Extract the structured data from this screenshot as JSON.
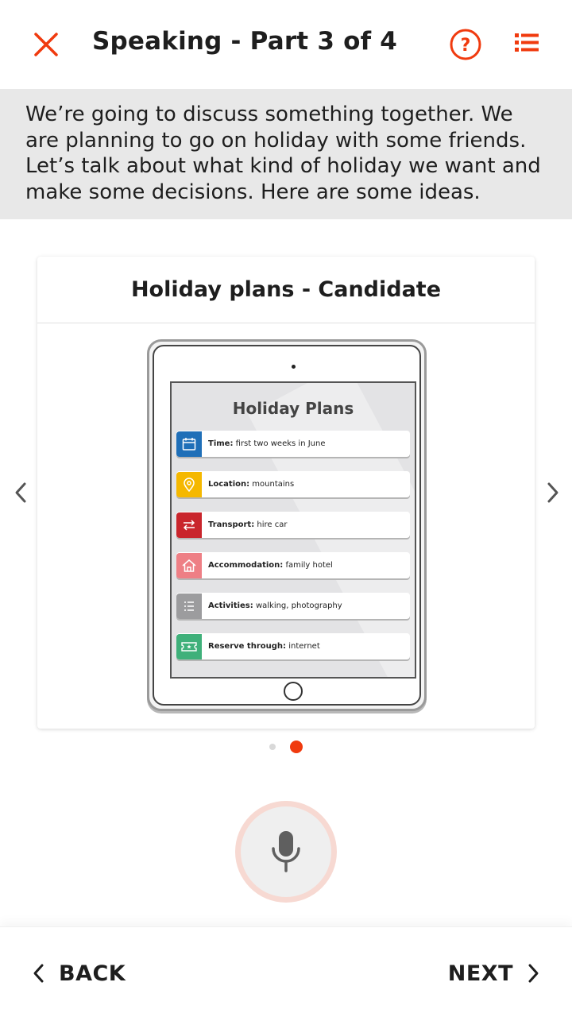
{
  "header": {
    "title": "Speaking - Part 3 of 4"
  },
  "instructions": {
    "text": "We’re going to discuss something together. We are planning to go on holiday with some friends. Let’s talk about what kind of holiday we want and make some decisions. Here are some ideas."
  },
  "card": {
    "title": "Holiday plans - Candidate",
    "screen_title": "Holiday Plans",
    "items": [
      {
        "label": "Time:",
        "value": " first two weeks in June",
        "color": "#1f6fb8",
        "icon": "calendar-icon"
      },
      {
        "label": "Location:",
        "value": " mountains",
        "color": "#f5b800",
        "icon": "location-pin-icon"
      },
      {
        "label": "Transport:",
        "value": " hire car",
        "color": "#c9252c",
        "icon": "transfer-arrows-icon"
      },
      {
        "label": "Accommodation:",
        "value": " family hotel",
        "color": "#ee7f85",
        "icon": "house-icon"
      },
      {
        "label": "Activities:",
        "value": " walking, photography",
        "color": "#9c9c9e",
        "icon": "list-icon"
      },
      {
        "label": "Reserve through:",
        "value": " internet",
        "color": "#3fb07a",
        "icon": "ticket-icon"
      }
    ]
  },
  "pagination": {
    "total": 2,
    "current": 2
  },
  "footer": {
    "back_label": "BACK",
    "next_label": "NEXT"
  },
  "colors": {
    "accent": "#f03a0e",
    "instruction_bg": "#e8e8e8"
  }
}
